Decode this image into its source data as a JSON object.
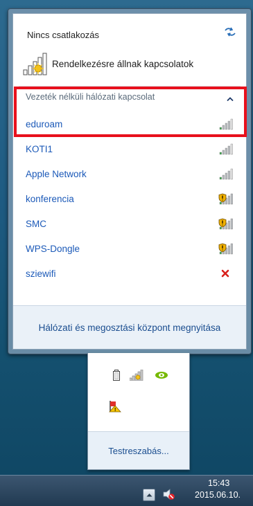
{
  "status": {
    "title": "Nincs csatlakozás",
    "available_label": "Rendelkezésre állnak kapcsolatok"
  },
  "section": {
    "header": "Vezeték nélküli hálózati kapcsolat"
  },
  "networks": [
    {
      "name": "eduroam",
      "signal_bars": 4,
      "secured": false,
      "status_icon": "signal-icon"
    },
    {
      "name": "KOTI1",
      "signal_bars": 4,
      "secured": false,
      "status_icon": "signal-icon"
    },
    {
      "name": "Apple Network",
      "signal_bars": 4,
      "secured": false,
      "status_icon": "signal-icon"
    },
    {
      "name": "konferencia",
      "signal_bars": 5,
      "secured": true,
      "status_icon": "signal-shield-icon"
    },
    {
      "name": "SMC",
      "signal_bars": 5,
      "secured": true,
      "status_icon": "signal-shield-icon"
    },
    {
      "name": "WPS-Dongle",
      "signal_bars": 5,
      "secured": true,
      "status_icon": "signal-shield-icon"
    },
    {
      "name": "sziewifi",
      "signal_bars": 0,
      "secured": false,
      "status_icon": "unavailable-x-icon"
    }
  ],
  "footer": {
    "link": "Hálózati és megosztási központ megnyitása"
  },
  "tray_overflow": {
    "icons_row1": [
      "battery-icon",
      "network-signal-icon",
      "nvidia-icon"
    ],
    "icons_row2": [
      "action-center-flag-icon"
    ],
    "customize_link": "Testreszabás..."
  },
  "taskbar": {
    "time": "15:43",
    "date": "2015.06.10."
  },
  "colors": {
    "link": "#1b59b8",
    "highlight": "#e8101c",
    "taskbar": "#213a52"
  }
}
